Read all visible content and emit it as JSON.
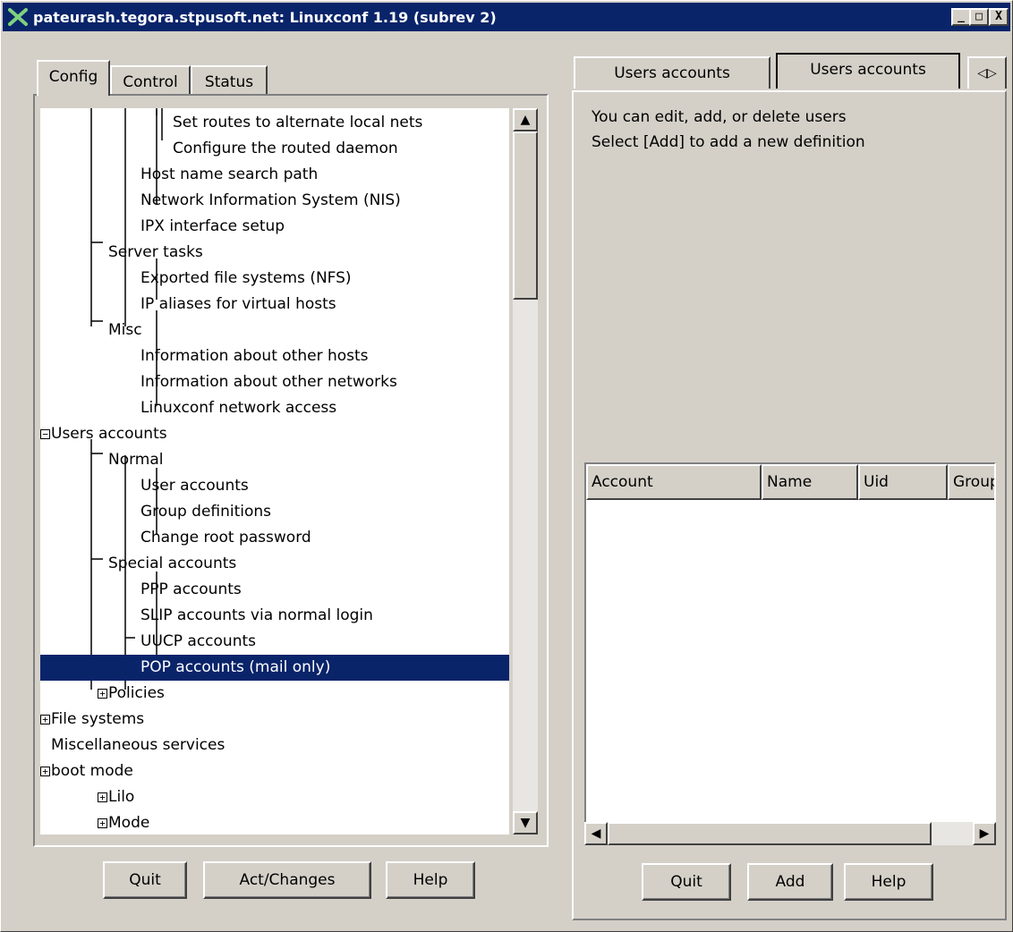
{
  "window": {
    "title": "pateurash.tegora.stpusoft.net: Linuxconf 1.19 (subrev 2)",
    "buttons": {
      "minimize": "_",
      "maximize": "□",
      "close": "X"
    }
  },
  "left": {
    "tabs": [
      {
        "label": "Config",
        "active": true
      },
      {
        "label": "Control",
        "active": false
      },
      {
        "label": "Status",
        "active": false
      }
    ],
    "tree": [
      {
        "label": "Set routes to alternate local nets",
        "level": 3
      },
      {
        "label": "Configure the routed daemon",
        "level": 3
      },
      {
        "label": "Host name search path",
        "level": 2
      },
      {
        "label": "Network Information System (NIS)",
        "level": 2
      },
      {
        "label": "IPX interface setup",
        "level": 2
      },
      {
        "label": "Server tasks",
        "level": 1
      },
      {
        "label": "Exported file systems (NFS)",
        "level": 2
      },
      {
        "label": "IP aliases for virtual hosts",
        "level": 2
      },
      {
        "label": "Misc",
        "level": 1
      },
      {
        "label": "Information about other hosts",
        "level": 2
      },
      {
        "label": "Information about other networks",
        "level": 2
      },
      {
        "label": "Linuxconf network access",
        "level": 2
      },
      {
        "label": "Users accounts",
        "level": 0,
        "expander": "−"
      },
      {
        "label": "Normal",
        "level": 1
      },
      {
        "label": "User accounts",
        "level": 2
      },
      {
        "label": "Group definitions",
        "level": 2
      },
      {
        "label": "Change root password",
        "level": 2
      },
      {
        "label": "Special accounts",
        "level": 1
      },
      {
        "label": "PPP accounts",
        "level": 2
      },
      {
        "label": "SLIP accounts via normal login",
        "level": 2
      },
      {
        "label": "UUCP accounts",
        "level": 2
      },
      {
        "label": "POP accounts (mail only)",
        "level": 2,
        "selected": true
      },
      {
        "label": "Policies",
        "level": 1,
        "expander": "+"
      },
      {
        "label": "File systems",
        "level": 0,
        "expander": "+"
      },
      {
        "label": "Miscellaneous services",
        "level": 0
      },
      {
        "label": "boot mode",
        "level": 0,
        "expander": "+"
      },
      {
        "label": "Lilo",
        "level": 1,
        "expander": "+"
      },
      {
        "label": "Mode",
        "level": 1,
        "expander": "+"
      }
    ],
    "buttons": {
      "quit": "Quit",
      "act": "Act/Changes",
      "help": "Help"
    }
  },
  "right": {
    "tabs": [
      {
        "label": "Users accounts",
        "active": false
      },
      {
        "label": "Users accounts",
        "active": true
      }
    ],
    "tab_nav": "◁▷",
    "description": [
      "You can edit, add, or delete users",
      "Select [Add] to add a new definition"
    ],
    "table": {
      "columns": [
        "Account",
        "Name",
        "Uid",
        "Group"
      ],
      "rows": []
    },
    "buttons": {
      "quit": "Quit",
      "add": "Add",
      "help": "Help"
    }
  },
  "colors": {
    "selection": "#0a246a",
    "titlebar": "#0a246a",
    "face": "#d4d0c8"
  }
}
